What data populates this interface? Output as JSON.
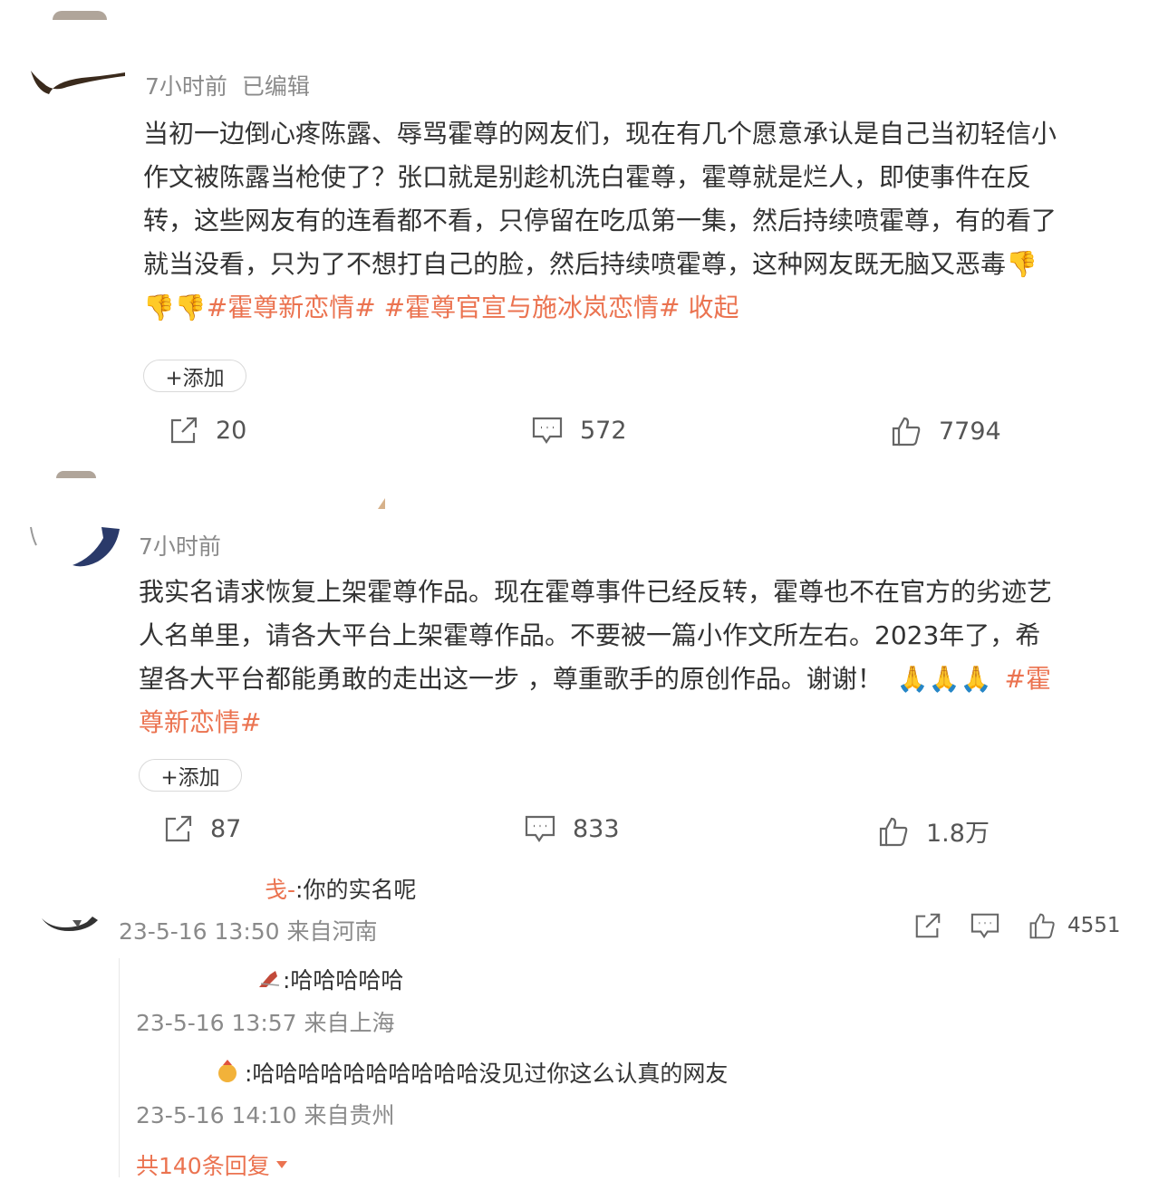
{
  "comment1": {
    "time": "7小时前",
    "edited": "已编辑",
    "lines": [
      "当初一边倒心疼陈露、辱骂霍尊的网友们，现在有几个愿意承认是自己当初轻信小",
      "作文被陈露当枪使了？张口就是别趁机洗白霍尊，霍尊就是烂人，即使事件在反",
      "转，这些网友有的连看都不看，只停留在吃瓜第一集，然后持续喷霍尊，有的看了",
      "就当没看，只为了不想打自己的脸，然后持续喷霍尊，这种网友既无脑又恶毒"
    ],
    "emoji": "👎",
    "tags": [
      "#霍尊新恋情#",
      "#霍尊官宣与施冰岚恋情#"
    ],
    "collapse": "收起",
    "add_label": "+添加",
    "repost_count": "20",
    "comment_count": "572",
    "like_count": "7794"
  },
  "comment2": {
    "time": "7小时前",
    "lines": [
      "我实名请求恢复上架霍尊作品。现在霍尊事件已经反转，霍尊也不在官方的劣迹艺",
      "人名单里，请各大平台上架霍尊作品。不要被一篇小作文所左右。2023年了，希",
      "望各大平台都能勇敢的走出这一步 ，尊重歌手的原创作品。谢谢！"
    ],
    "emoji": "🙏",
    "tag_part1": "#霍",
    "tag_part2": "尊新恋情#",
    "add_label": "+添加",
    "repost_count": "87",
    "comment_count": "833",
    "like_count": "1.8万"
  },
  "reply1": {
    "name_fragment": "戋-",
    "text": ":你的实名呢",
    "meta": "23-5-16 13:50 来自河南",
    "like_count": "4551"
  },
  "reply2": {
    "text": ":哈哈哈哈哈",
    "meta": "23-5-16 13:57 来自上海"
  },
  "reply3": {
    "text": ":哈哈哈哈哈哈哈哈哈哈没见过你这么认真的网友",
    "meta": "23-5-16 14:10 来自贵州"
  },
  "more_replies": "共140条回复",
  "colors": {
    "accent": "#eb7350",
    "meta": "#8a8a8a",
    "text": "#333333"
  }
}
